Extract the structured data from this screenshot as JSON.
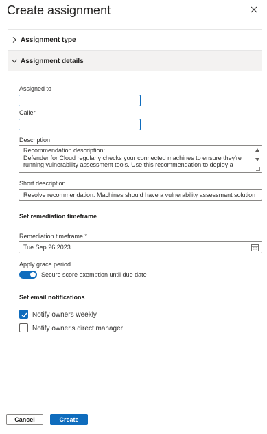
{
  "panel": {
    "title": "Create assignment",
    "close_icon": "close-icon"
  },
  "sections": {
    "assignment_type": {
      "label": "Assignment type",
      "expanded": false
    },
    "assignment_details": {
      "label": "Assignment details",
      "expanded": true
    }
  },
  "form": {
    "assigned_to": {
      "label": "Assigned to",
      "value": ""
    },
    "caller": {
      "label": "Caller",
      "value": ""
    },
    "description": {
      "label": "Description",
      "lines": [
        "Recommendation description:",
        "  Defender for Cloud regularly checks your connected machines to ensure they're",
        "running vulnerability assessment tools. Use this recommendation to deploy a"
      ]
    },
    "short_description": {
      "label": "Short description",
      "value": "Resolve recommendation: Machines should have a vulnerability assessment solution"
    },
    "remediation_heading": "Set remediation timeframe",
    "remediation_timeframe": {
      "label": "Remediation timeframe *",
      "value": "Tue Sep 26 2023",
      "icon": "calendar-icon"
    },
    "grace_period": {
      "label": "Apply grace period",
      "toggle_on": true,
      "toggle_label": "Secure score exemption until due date"
    },
    "email_heading": "Set email notifications",
    "notify_weekly": {
      "label": "Notify owners weekly",
      "checked": true
    },
    "notify_manager": {
      "label": "Notify owner's direct manager",
      "checked": false
    }
  },
  "footer": {
    "cancel_label": "Cancel",
    "create_label": "Create"
  },
  "colors": {
    "accent": "#0f6cbd",
    "border": "#8a8886",
    "section_bg": "#f3f2f1"
  }
}
